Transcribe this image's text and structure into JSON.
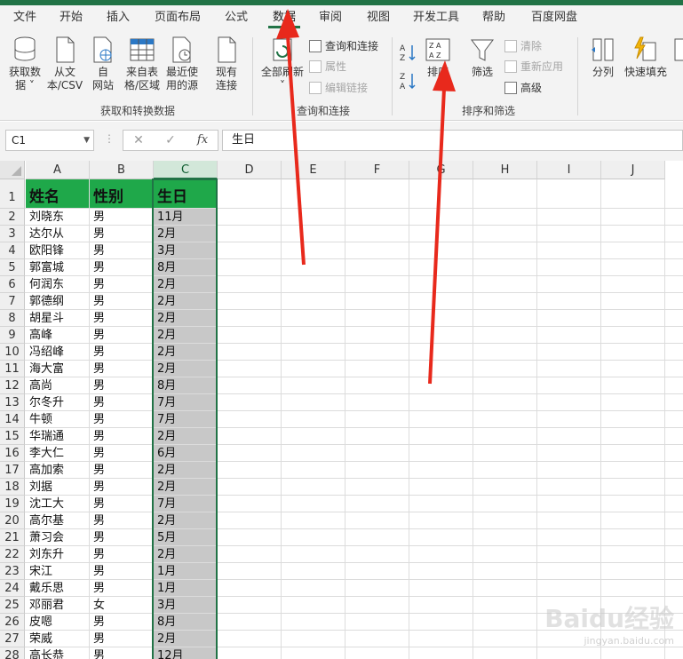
{
  "tabs": [
    "文件",
    "开始",
    "插入",
    "页面布局",
    "公式",
    "数据",
    "审阅",
    "视图",
    "开发工具",
    "帮助",
    "百度网盘"
  ],
  "active_tab": "数据",
  "ribbon": {
    "get_data": [
      "获取数",
      "据"
    ],
    "from_csv": [
      "从文",
      "本/CSV"
    ],
    "from_web": [
      "自",
      "网站"
    ],
    "from_table": [
      "来自表",
      "格/区域"
    ],
    "recent_sources": [
      "最近使",
      "用的源"
    ],
    "existing": [
      "现有",
      "连接"
    ],
    "refresh_all": "全部刷新",
    "queries_connections": "查询和连接",
    "properties": "属性",
    "edit_links": "编辑链接",
    "sort": "排序",
    "filter": "筛选",
    "clear": "清除",
    "reapply": "重新应用",
    "advanced": "高级",
    "text_to_columns": "分列",
    "flash_fill": "快速填充",
    "group_get_transform": "获取和转换数据",
    "group_queries": "查询和连接",
    "group_sort_filter": "排序和筛选"
  },
  "formula_bar": {
    "name_box": "C1",
    "cancel": "✕",
    "enter": "✓",
    "fx": "fx",
    "content": "生日"
  },
  "columns": [
    "A",
    "B",
    "C",
    "D",
    "E",
    "F",
    "G",
    "H",
    "I",
    "J"
  ],
  "selected_column": "C",
  "headers": [
    "姓名",
    "性别",
    "生日"
  ],
  "rows": [
    [
      "刘晓东",
      "男",
      "11月"
    ],
    [
      "达尔从",
      "男",
      "2月"
    ],
    [
      "欧阳锋",
      "男",
      "3月"
    ],
    [
      "郭富城",
      "男",
      "8月"
    ],
    [
      "何润东",
      "男",
      "2月"
    ],
    [
      "郭德纲",
      "男",
      "2月"
    ],
    [
      "胡星斗",
      "男",
      "2月"
    ],
    [
      "高峰",
      "男",
      "2月"
    ],
    [
      "冯绍峰",
      "男",
      "2月"
    ],
    [
      "海大富",
      "男",
      "2月"
    ],
    [
      "高尚",
      "男",
      "8月"
    ],
    [
      "尔冬升",
      "男",
      "7月"
    ],
    [
      "牛顿",
      "男",
      "7月"
    ],
    [
      "华瑞通",
      "男",
      "2月"
    ],
    [
      "李大仁",
      "男",
      "6月"
    ],
    [
      "高加索",
      "男",
      "2月"
    ],
    [
      "刘据",
      "男",
      "2月"
    ],
    [
      "沈工大",
      "男",
      "7月"
    ],
    [
      "高尔基",
      "男",
      "2月"
    ],
    [
      "萧习会",
      "男",
      "5月"
    ],
    [
      "刘东升",
      "男",
      "2月"
    ],
    [
      "宋江",
      "男",
      "1月"
    ],
    [
      "戴乐思",
      "男",
      "1月"
    ],
    [
      "邓丽君",
      "女",
      "3月"
    ],
    [
      "皮嗯",
      "男",
      "8月"
    ],
    [
      "荣威",
      "男",
      "2月"
    ],
    [
      "高长恭",
      "男",
      "12月"
    ]
  ],
  "watermark": "Baidu经验",
  "watermark_url": "jingyan.baidu.com",
  "colors": {
    "excel_green": "#217346",
    "header_fill": "#1fa84a",
    "selection_fill": "#c8c8c8",
    "arrow": "#e8291c"
  }
}
